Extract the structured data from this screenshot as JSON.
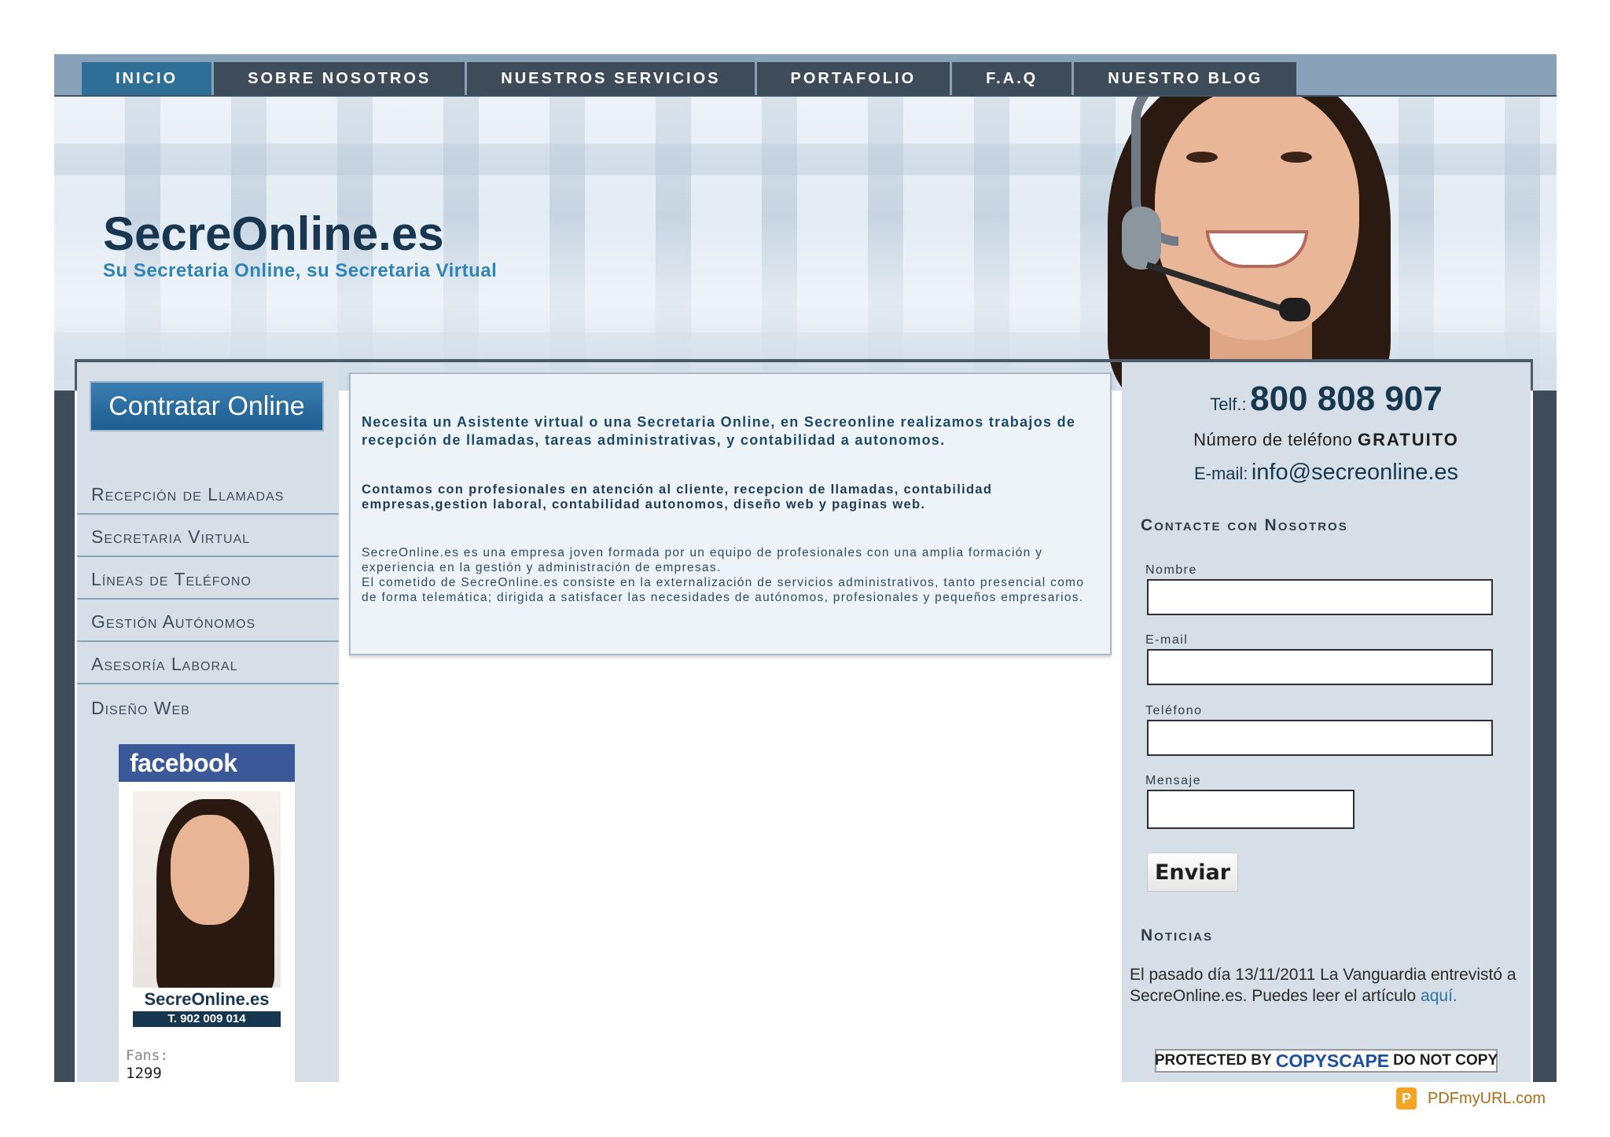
{
  "nav": {
    "items": [
      {
        "label": "INICIO",
        "active": true
      },
      {
        "label": "SOBRE NOSOTROS",
        "active": false
      },
      {
        "label": "NUESTROS SERVICIOS",
        "active": false
      },
      {
        "label": "PORTAFOLIO",
        "active": false
      },
      {
        "label": "F.A.Q",
        "active": false
      },
      {
        "label": "NUESTRO BLOG",
        "active": false
      }
    ]
  },
  "header": {
    "title": "SecreOnline.es",
    "subtitle": "Su Secretaria Online, su Secretaria Virtual"
  },
  "sidebar": {
    "cta_label": "Contratar Online",
    "menu": [
      {
        "label": "Recepción de Llamadas"
      },
      {
        "label": "Secretaria Virtual"
      },
      {
        "label": "Líneas de Teléfono"
      },
      {
        "label": "Gestión Autónomos"
      },
      {
        "label": "Asesoría Laboral"
      },
      {
        "label": "Diseño Web"
      }
    ],
    "facebook": {
      "brand": "facebook",
      "logo_text": "SecreOnline.es",
      "logo_phone": "T. 902 009 014",
      "fans_label": "Fans:",
      "fans_count": "1299"
    }
  },
  "content": {
    "paragraph1": "Necesita un Asistente virtual o una Secretaria Online, en Secreonline realizamos trabajos de recepción de llamadas, tareas administrativas, y contabilidad a autonomos.",
    "paragraph2": "Contamos con profesionales en atención al cliente, recepcion de llamadas, contabilidad empresas,gestion laboral, contabilidad autonomos, diseño web y paginas web.",
    "paragraph3a": "SecreOnline.es es una empresa joven formada por un equipo de profesionales con una amplia formación y experiencia en la gestión y administración de empresas.",
    "paragraph3b": "El cometido de SecreOnline.es consiste en la externalización de servicios administrativos, tanto presencial como de forma telemática; dirigida a satisfacer las necesidades de autónomos, profesionales y pequeños empresarios."
  },
  "contact": {
    "tel_label": "Telf.:",
    "tel_number": "800 808 907",
    "freephone_prefix": "Número de teléfono",
    "freephone_bold": "GRATUITO",
    "email_label": "E-mail:",
    "email_value": "info@secreonline.es",
    "form_title": "Contacte con Nosotros",
    "fields": {
      "name_label": "Nombre",
      "email_label": "E-mail",
      "phone_label": "Teléfono",
      "message_label": "Mensaje"
    },
    "send_label": "Enviar"
  },
  "news": {
    "title": "Noticias",
    "text": "El pasado día 13/11/2011 La Vanguardia entrevistó a SecreOnline.es. Puedes leer el artículo",
    "link_label": "aquí."
  },
  "copyscape": {
    "prefix": "PROTECTED BY",
    "brand": "COPYSCAPE",
    "suffix": "DO NOT COPY"
  },
  "footer": {
    "pdf_icon": "P",
    "pdf_text": "PDFmyURL.com"
  },
  "colors": {
    "nav_bg": "#3e4c5a",
    "nav_active": "#2e6e97",
    "title": "#17364f",
    "subtitle": "#2f84b5",
    "sidebar_bg": "#d6dfe8",
    "facebook": "#3b5998"
  }
}
